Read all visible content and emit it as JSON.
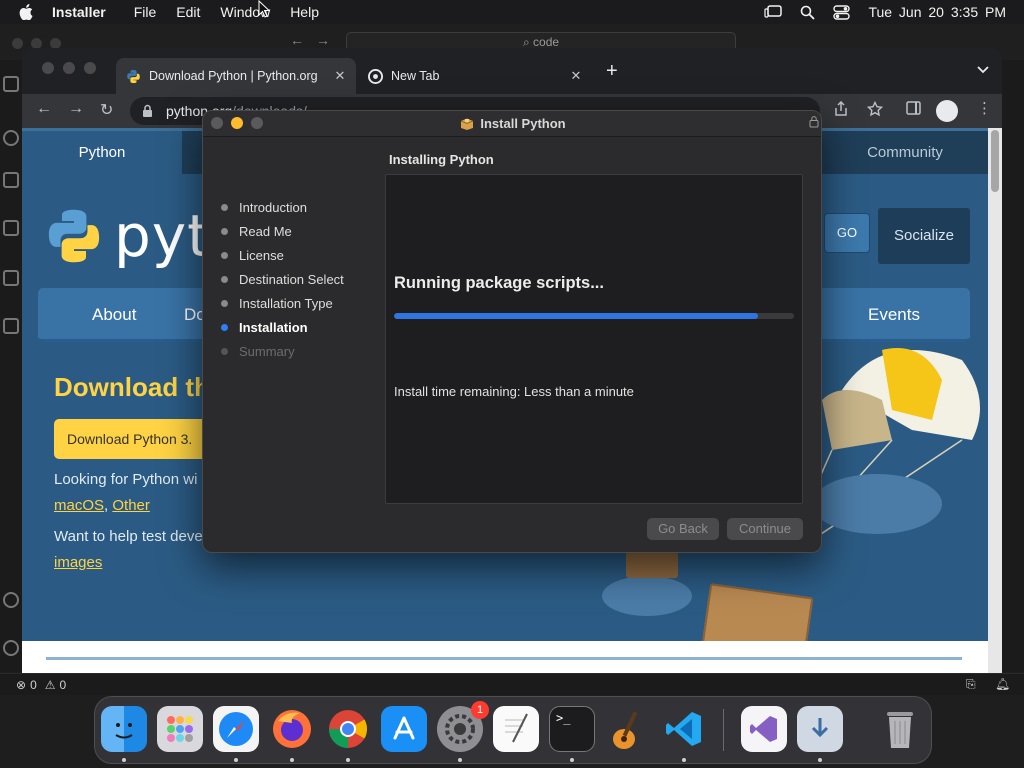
{
  "menubar": {
    "app_name": "Installer",
    "items": [
      "File",
      "Edit",
      "Window",
      "Help"
    ],
    "clock": "Tue Jun 20  3:35 PM"
  },
  "vscode": {
    "search_placeholder": "code",
    "status": {
      "errors": "0",
      "warnings": "0"
    }
  },
  "chrome": {
    "tabs": [
      {
        "title": "Download Python | Python.org",
        "active": true
      },
      {
        "title": "New Tab",
        "active": false
      }
    ],
    "url_host": "python.org",
    "url_path": "/downloads/"
  },
  "page": {
    "nav_python": "Python",
    "nav_community": "Community",
    "logo_text": "pyth",
    "go_label": "GO",
    "socialize_label": "Socialize",
    "main_nav": [
      "About",
      "Do",
      "Events"
    ],
    "headline": "Download th",
    "download_button": "Download Python 3.",
    "para1": "Looking for Python wi",
    "link_macos": "macOS",
    "comma": ",",
    "link_other": "Other",
    "para2": "Want to help test deve",
    "link_images": "images"
  },
  "installer": {
    "window_title": "Install Python",
    "heading": "Installing Python",
    "steps": [
      {
        "label": "Introduction",
        "state": "done"
      },
      {
        "label": "Read Me",
        "state": "done"
      },
      {
        "label": "License",
        "state": "done"
      },
      {
        "label": "Destination Select",
        "state": "done"
      },
      {
        "label": "Installation Type",
        "state": "done"
      },
      {
        "label": "Installation",
        "state": "current"
      },
      {
        "label": "Summary",
        "state": "pending"
      }
    ],
    "status_title": "Running package scripts...",
    "progress": 0.91,
    "time_remaining": "Install time remaining: Less than a minute",
    "go_back_label": "Go Back",
    "continue_label": "Continue"
  },
  "dock": {
    "apps": [
      "Finder",
      "Launchpad",
      "Safari",
      "Firefox",
      "Google Chrome",
      "App Store",
      "System Settings",
      "TextEdit",
      "Terminal",
      "GarageBand",
      "Visual Studio Code",
      "Visual Studio",
      "Downloads",
      "Trash"
    ],
    "settings_badge": "1"
  },
  "colors": {
    "python_blue": "#2b5b84",
    "python_yellow": "#ffd343",
    "progress_blue": "#2f74e0",
    "selected_step": "#2f7ff6"
  }
}
